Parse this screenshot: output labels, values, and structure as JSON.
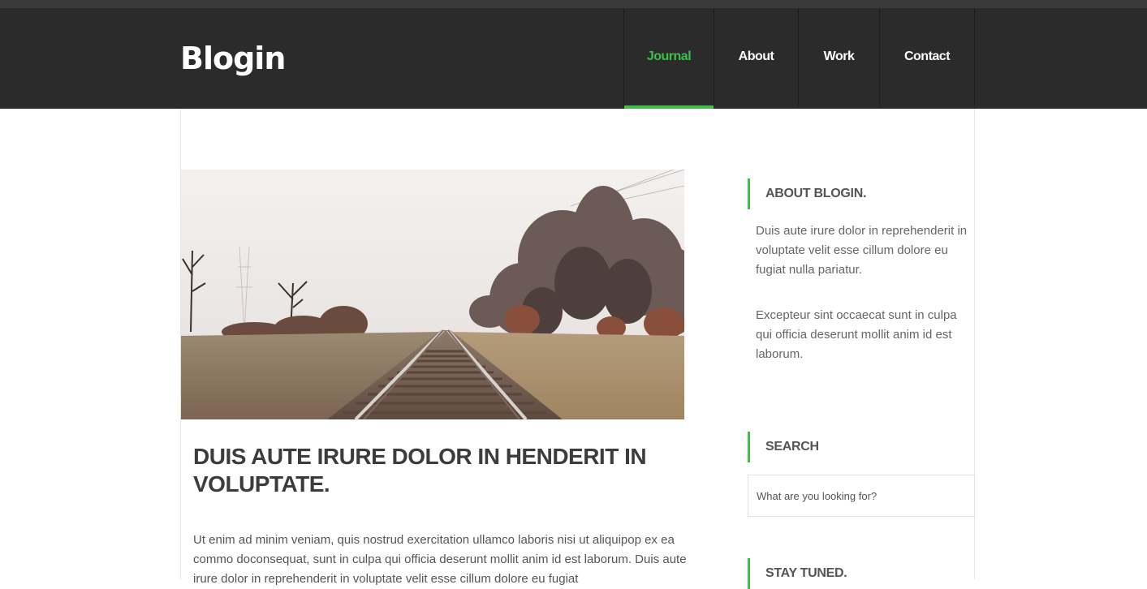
{
  "header": {
    "logo": "Blogin",
    "nav": [
      {
        "label": "Journal",
        "active": true
      },
      {
        "label": "About",
        "active": false
      },
      {
        "label": "Work",
        "active": false
      },
      {
        "label": "Contact",
        "active": false
      }
    ]
  },
  "post": {
    "title": "DUIS AUTE IRURE DOLOR IN HENDERIT IN VOLUPTATE.",
    "body": "Ut enim ad minim veniam, quis nostrud exercitation ullamco laboris nisi ut aliquipop ex ea commo doconsequat, sunt in culpa qui officia deserunt mollit anim id est laborum. Duis aute irure dolor in reprehenderit in voluptate velit esse cillum dolore eu fugiat"
  },
  "sidebar": {
    "about": {
      "title": "ABOUT BLOGIN.",
      "paragraphs": [
        "Duis aute irure dolor in reprehenderit in voluptate velit esse cillum dolore eu fugiat nulla pariatur.",
        "Excepteur sint occaecat sunt in culpa qui officia deserunt mollit anim id est laborum."
      ]
    },
    "search": {
      "title": "SEARCH",
      "placeholder": "What are you looking for?"
    },
    "stay_tuned": {
      "title": "STAY TUNED."
    }
  },
  "colors": {
    "accent": "#3fbf4a",
    "header_bg": "#2b2b2b"
  }
}
